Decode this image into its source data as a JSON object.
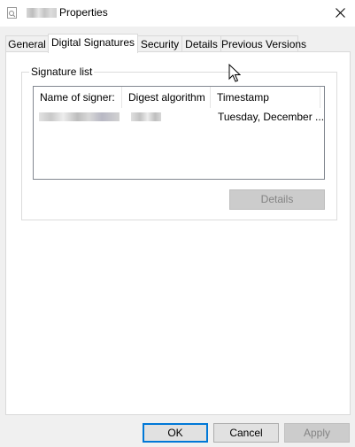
{
  "window": {
    "title": "Properties",
    "close_icon": "close-icon"
  },
  "tabs": [
    {
      "label": "General",
      "active": false
    },
    {
      "label": "Digital Signatures",
      "active": true
    },
    {
      "label": "Security",
      "active": false
    },
    {
      "label": "Details",
      "active": false
    },
    {
      "label": "Previous Versions",
      "active": false
    }
  ],
  "signature_group": {
    "label": "Signature list",
    "columns": [
      "Name of signer:",
      "Digest algorithm",
      "Timestamp"
    ],
    "rows": [
      {
        "timestamp": "Tuesday, December ..."
      }
    ],
    "details_button": "Details"
  },
  "footer": {
    "ok": "OK",
    "cancel": "Cancel",
    "apply": "Apply"
  }
}
